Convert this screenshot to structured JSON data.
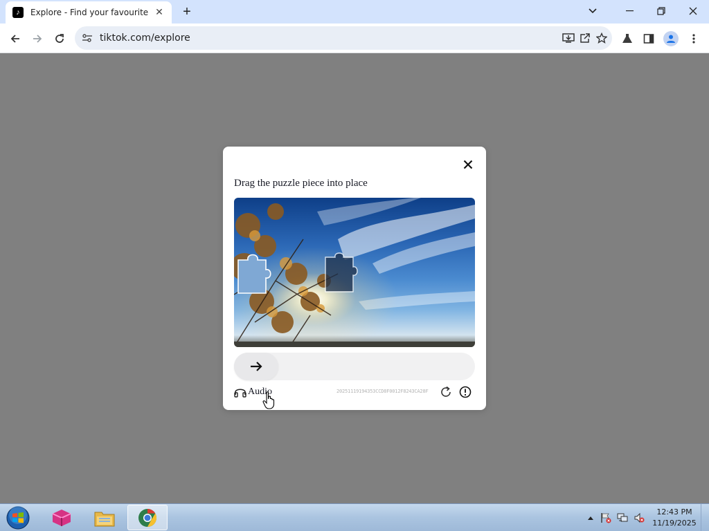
{
  "browser": {
    "tab": {
      "title": "Explore - Find your favourite vid",
      "favicon": "tiktok-icon"
    },
    "address": {
      "url": "tiktok.com/explore"
    }
  },
  "captcha": {
    "instruction": "Drag the puzzle piece into place",
    "audio_label": "Audio",
    "challenge_id": "20251119194353CCD8F0012F8243CA28F",
    "slider_progress": 0
  },
  "taskbar": {
    "time": "12:43 PM",
    "date": "11/19/2025",
    "apps": [
      "start-orb",
      "app-icon",
      "file-explorer-icon",
      "chrome-icon"
    ]
  },
  "colors": {
    "tabstrip": "#d3e3fd",
    "overlay": "#808080",
    "accent": "#1a73e8"
  }
}
